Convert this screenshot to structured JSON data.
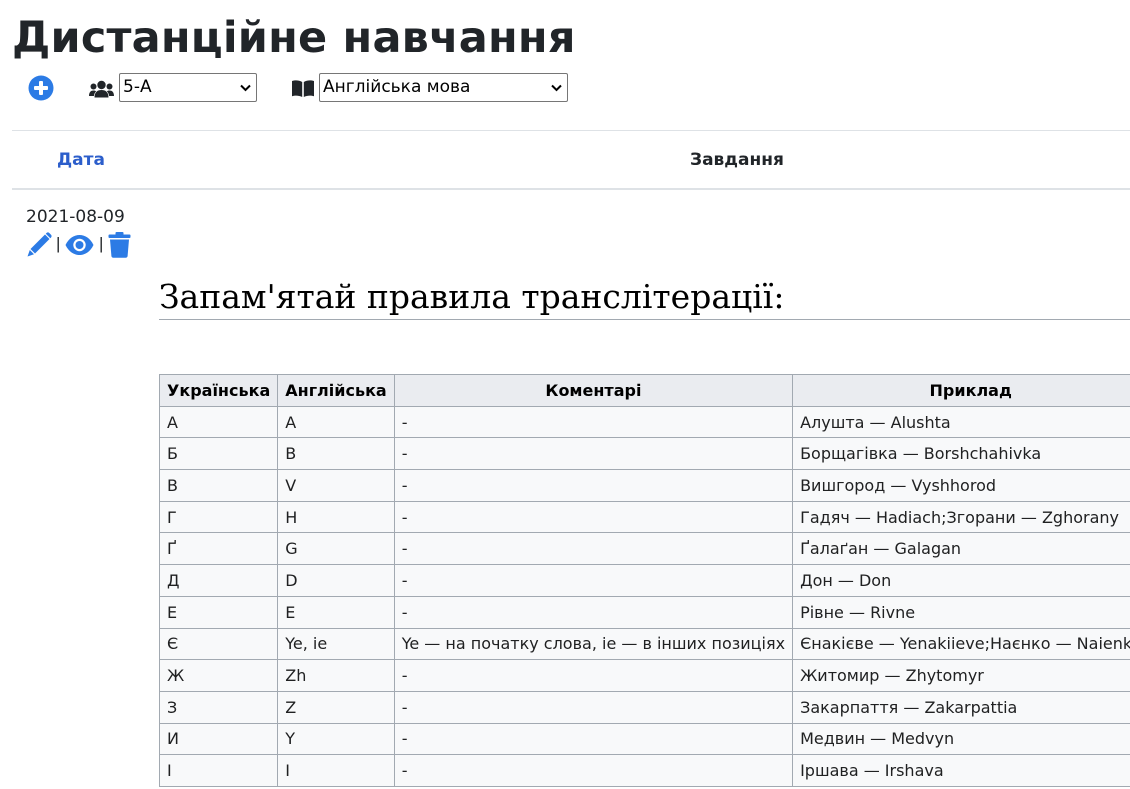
{
  "page": {
    "title": "Дистанційне навчання"
  },
  "toolbar": {
    "class_selected": "5-А",
    "subject_selected": "Англійська мова"
  },
  "table_header": {
    "date": "Дата",
    "task": "Завдання"
  },
  "entry": {
    "date": "2021-08-09",
    "separator": "|",
    "task_title": "Запам'ятай правила транслітерації:",
    "columns": [
      "Українська",
      "Англійська",
      "Коментарі",
      "Приклад"
    ],
    "rows": [
      [
        "А",
        "A",
        "-",
        "Алушта — Alushta"
      ],
      [
        "Б",
        "B",
        "-",
        "Борщагівка — Borshchahivka"
      ],
      [
        "В",
        "V",
        "-",
        "Вишгород — Vyshhorod"
      ],
      [
        "Г",
        "H",
        "-",
        "Гадяч — Hadiach;Згорани — Zghorany"
      ],
      [
        "Ґ",
        "G",
        "-",
        "Ґалаґан — Galagan"
      ],
      [
        "Д",
        "D",
        "-",
        "Дон — Don"
      ],
      [
        "Е",
        "E",
        "-",
        "Рівне — Rivne"
      ],
      [
        "Є",
        "Ye, ie",
        "Ye — на початку слова, ie — в інших позиціях",
        "Єнакієве — Yenakiieve;Наєнко — Naienko"
      ],
      [
        "Ж",
        "Zh",
        "-",
        "Житомир — Zhytomyr"
      ],
      [
        "З",
        "Z",
        "-",
        "Закарпаття — Zakarpattia"
      ],
      [
        "И",
        "Y",
        "-",
        "Медвин — Medvyn"
      ],
      [
        "І",
        "I",
        "-",
        "Іршава — Irshava"
      ]
    ]
  },
  "colors": {
    "accent": "#2c7be5",
    "link": "#2c5ecb",
    "text": "#212529"
  }
}
